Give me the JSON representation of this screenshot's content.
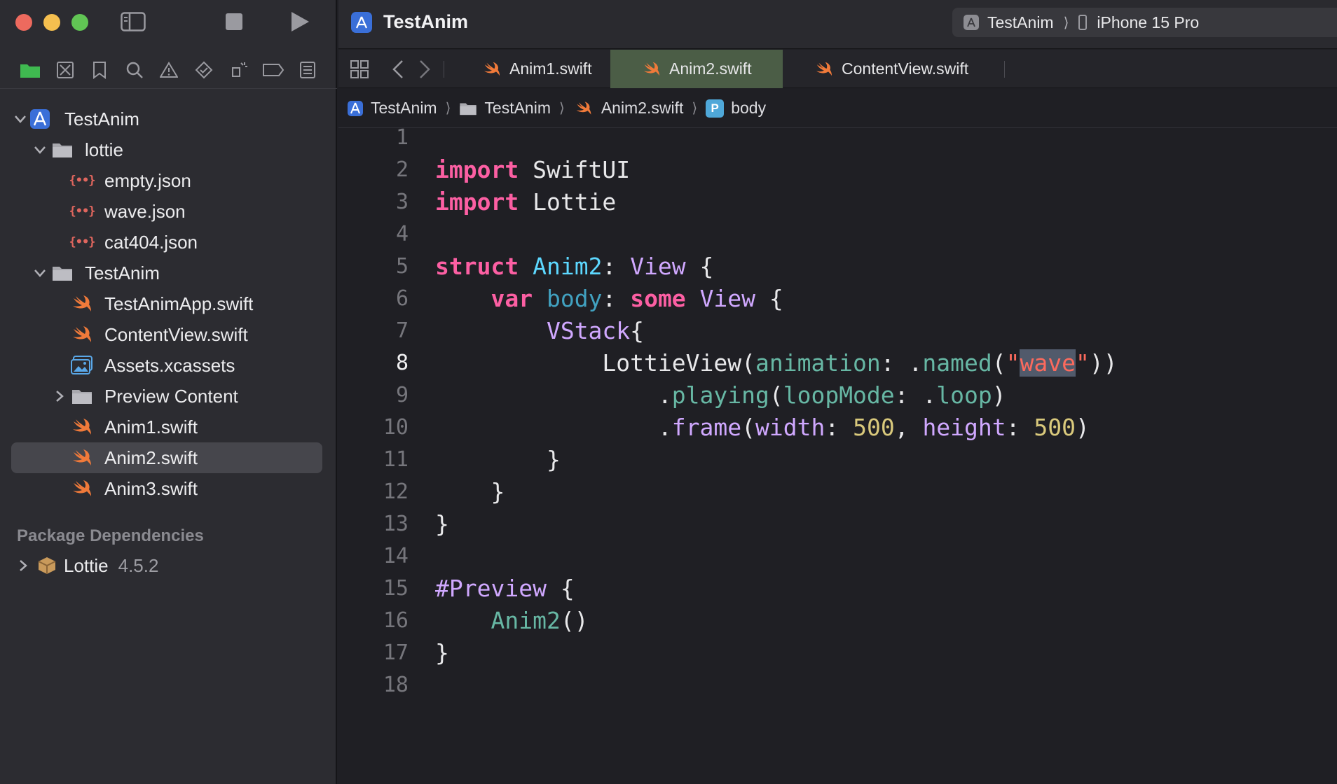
{
  "window": {
    "title": "TestAnim",
    "scheme": {
      "target": "TestAnim",
      "device": "iPhone 15 Pro"
    }
  },
  "sidebar": {
    "tree": [
      {
        "label": "TestAnim",
        "kind": "project",
        "level": 0,
        "expanded": true
      },
      {
        "label": "lottie",
        "kind": "folder",
        "level": 1,
        "expanded": true
      },
      {
        "label": "empty.json",
        "kind": "json",
        "level": 2
      },
      {
        "label": "wave.json",
        "kind": "json",
        "level": 2
      },
      {
        "label": "cat404.json",
        "kind": "json",
        "level": 2
      },
      {
        "label": "TestAnim",
        "kind": "folder",
        "level": 1,
        "expanded": true
      },
      {
        "label": "TestAnimApp.swift",
        "kind": "swift",
        "level": 2
      },
      {
        "label": "ContentView.swift",
        "kind": "swift",
        "level": 2
      },
      {
        "label": "Assets.xcassets",
        "kind": "assets",
        "level": 2
      },
      {
        "label": "Preview Content",
        "kind": "folder",
        "level": 2,
        "expanded": false
      },
      {
        "label": "Anim1.swift",
        "kind": "swift",
        "level": 2
      },
      {
        "label": "Anim2.swift",
        "kind": "swift",
        "level": 2,
        "selected": true
      },
      {
        "label": "Anim3.swift",
        "kind": "swift",
        "level": 2
      }
    ],
    "package_header": "Package Dependencies",
    "package": {
      "name": "Lottie",
      "version": "4.5.2"
    }
  },
  "tabs": [
    {
      "label": "Anim1.swift",
      "active": false
    },
    {
      "label": "Anim2.swift",
      "active": true
    },
    {
      "label": "ContentView.swift",
      "active": false
    }
  ],
  "jumpbar": [
    "TestAnim",
    "TestAnim",
    "Anim2.swift",
    "body"
  ],
  "editor": {
    "current_line": 8,
    "lines": [
      {
        "n": "1",
        "tokens": []
      },
      {
        "n": "2",
        "tokens": [
          [
            "kw",
            "import"
          ],
          [
            "plain",
            " SwiftUI"
          ]
        ]
      },
      {
        "n": "3",
        "tokens": [
          [
            "kw",
            "import"
          ],
          [
            "plain",
            " Lottie"
          ]
        ]
      },
      {
        "n": "4",
        "tokens": []
      },
      {
        "n": "5",
        "tokens": [
          [
            "kw",
            "struct"
          ],
          [
            "plain",
            " "
          ],
          [
            "ty2",
            "Anim2"
          ],
          [
            "plain",
            ": "
          ],
          [
            "ty",
            "View"
          ],
          [
            "plain",
            " {"
          ]
        ]
      },
      {
        "n": "6",
        "tokens": [
          [
            "plain",
            "    "
          ],
          [
            "kw",
            "var"
          ],
          [
            "plain",
            " "
          ],
          [
            "prop",
            "body"
          ],
          [
            "plain",
            ": "
          ],
          [
            "kw",
            "some"
          ],
          [
            "plain",
            " "
          ],
          [
            "ty",
            "View"
          ],
          [
            "plain",
            " {"
          ]
        ]
      },
      {
        "n": "7",
        "tokens": [
          [
            "plain",
            "        "
          ],
          [
            "ty",
            "VStack"
          ],
          [
            "plain",
            "{"
          ]
        ]
      },
      {
        "n": "8",
        "tokens": [
          [
            "plain",
            "            LottieView("
          ],
          [
            "fn",
            "animation"
          ],
          [
            "plain",
            ": ."
          ],
          [
            "fn",
            "named"
          ],
          [
            "plain",
            "("
          ],
          [
            "str",
            "\""
          ],
          [
            "str-sel",
            "wave"
          ],
          [
            "str",
            "\""
          ],
          [
            "plain",
            "))"
          ]
        ]
      },
      {
        "n": "9",
        "tokens": [
          [
            "plain",
            "                ."
          ],
          [
            "fn",
            "playing"
          ],
          [
            "plain",
            "("
          ],
          [
            "fn",
            "loopMode"
          ],
          [
            "plain",
            ": ."
          ],
          [
            "fn",
            "loop"
          ],
          [
            "plain",
            ")"
          ]
        ]
      },
      {
        "n": "10",
        "tokens": [
          [
            "plain",
            "                ."
          ],
          [
            "ty",
            "frame"
          ],
          [
            "plain",
            "("
          ],
          [
            "ty",
            "width"
          ],
          [
            "plain",
            ": "
          ],
          [
            "num",
            "500"
          ],
          [
            "plain",
            ", "
          ],
          [
            "ty",
            "height"
          ],
          [
            "plain",
            ": "
          ],
          [
            "num",
            "500"
          ],
          [
            "plain",
            ")"
          ]
        ]
      },
      {
        "n": "11",
        "tokens": [
          [
            "plain",
            "        }"
          ]
        ]
      },
      {
        "n": "12",
        "tokens": [
          [
            "plain",
            "    }"
          ]
        ]
      },
      {
        "n": "13",
        "tokens": [
          [
            "plain",
            "}"
          ]
        ]
      },
      {
        "n": "14",
        "tokens": []
      },
      {
        "n": "15",
        "tokens": [
          [
            "ty",
            "#Preview"
          ],
          [
            "plain",
            " {"
          ]
        ]
      },
      {
        "n": "16",
        "tokens": [
          [
            "plain",
            "    "
          ],
          [
            "fn",
            "Anim2"
          ],
          [
            "plain",
            "()"
          ]
        ]
      },
      {
        "n": "17",
        "tokens": [
          [
            "plain",
            "}"
          ]
        ]
      },
      {
        "n": "18",
        "tokens": []
      }
    ]
  },
  "colors": {
    "keyword": "#fc5fa3",
    "type": "#d0a8ff",
    "declared_type": "#5dd8ff",
    "function": "#67b7a4",
    "string": "#fc6a5d",
    "number": "#d9c97c",
    "active_tab": "#4b5d46",
    "swift_icon": "#f07a3a"
  },
  "icons": {
    "toolbar": [
      "sidebar-toggle-icon",
      "stop-icon",
      "run-icon"
    ],
    "navigators": [
      "folder-icon",
      "source-control-icon",
      "bookmark-icon",
      "search-icon",
      "warning-icon",
      "test-icon",
      "debug-icon",
      "breakpoint-icon",
      "report-icon"
    ]
  }
}
